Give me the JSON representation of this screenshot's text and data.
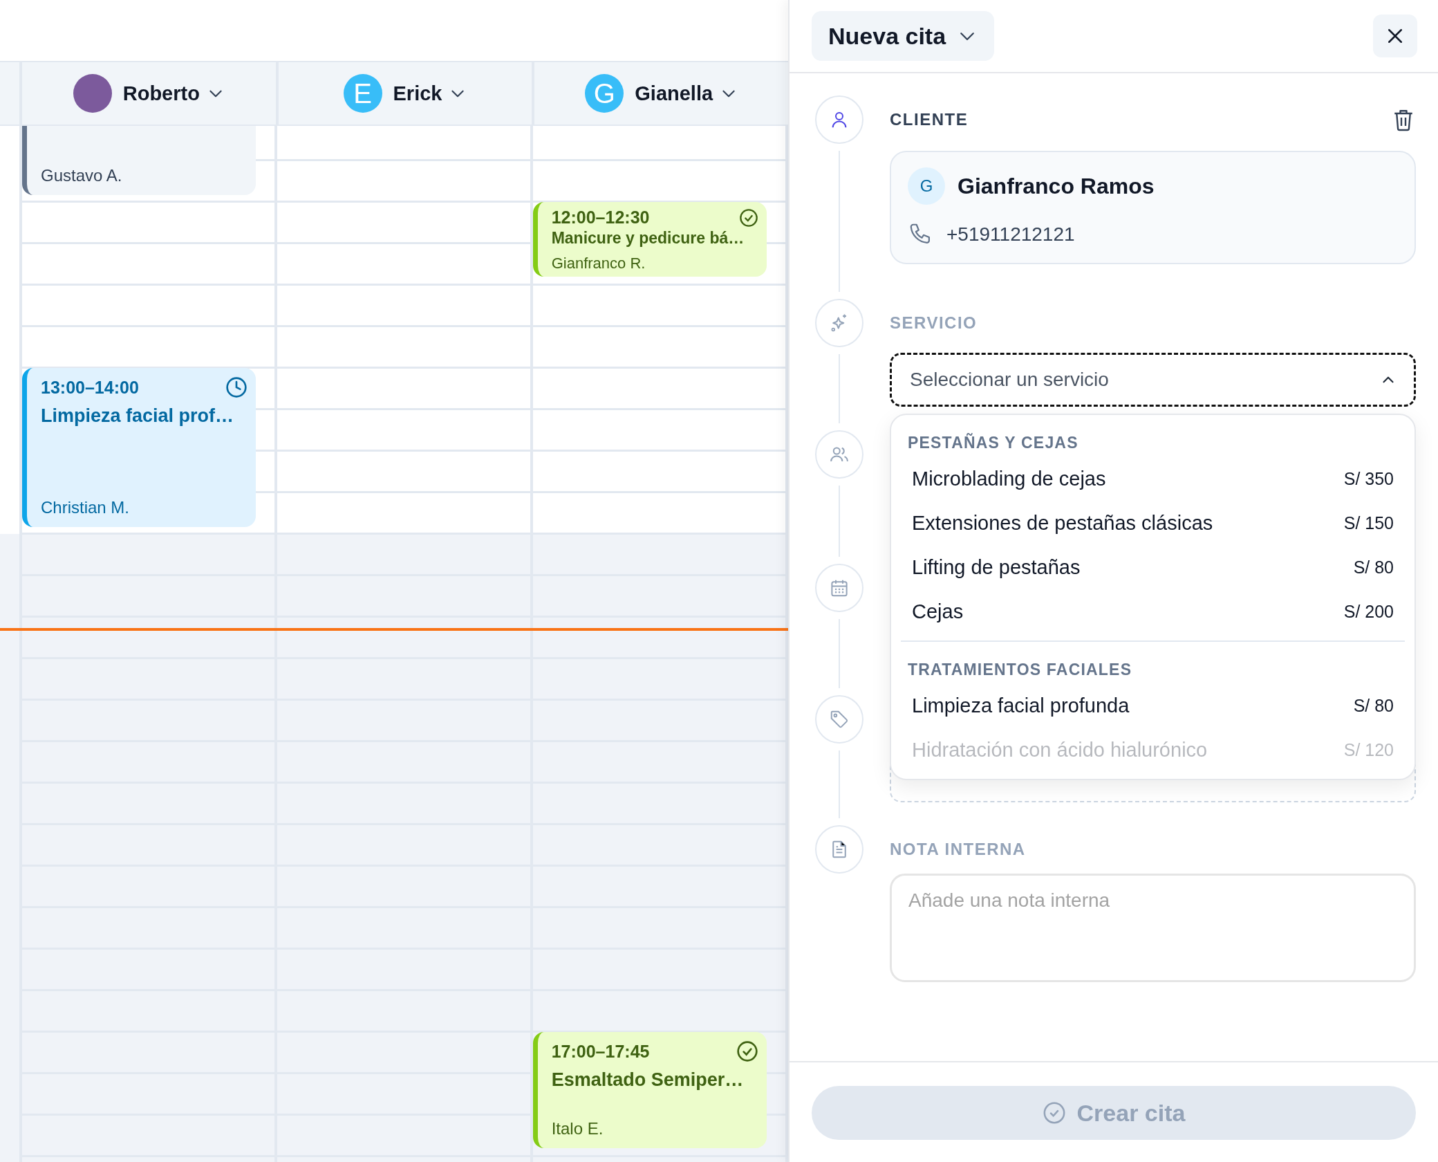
{
  "calendar": {
    "staff": [
      {
        "name": "Roberto",
        "events": [
          {
            "kind": "past",
            "client": "Gustavo A."
          },
          {
            "kind": "scheduled",
            "time": "13:00–14:00",
            "title": "Limpieza facial prof…",
            "client": "Christian M."
          }
        ]
      },
      {
        "name": "Erick",
        "initial": "E"
      },
      {
        "name": "Gianella",
        "initial": "G",
        "events": [
          {
            "kind": "done",
            "time": "12:00–12:30",
            "title": "Manicure y pedicure bá…",
            "client": "Gianfranco R."
          },
          {
            "kind": "done",
            "time": "17:00–17:45",
            "title": "Esmaltado Semiper…",
            "client": "Italo E."
          }
        ]
      }
    ]
  },
  "panel": {
    "title": "Nueva cita",
    "sections": [
      {
        "kind": "client",
        "active": true,
        "label": "CLIENTE",
        "client": {
          "initial": "G",
          "name": "Gianfranco Ramos",
          "phone": "+51911212121"
        }
      },
      {
        "kind": "service",
        "active": false,
        "label": "SERVICIO",
        "select": {
          "placeholder": "Seleccionar un servicio",
          "expanded": true,
          "groups": [
            {
              "title": "PESTAÑAS Y CEJAS",
              "items": [
                {
                  "name": "Microblading de cejas",
                  "price": "S/ 350",
                  "faded": false
                },
                {
                  "name": "Extensiones de pestañas clásicas",
                  "price": "S/ 150",
                  "faded": false
                },
                {
                  "name": "Lifting de pestañas",
                  "price": "S/ 80",
                  "faded": false
                },
                {
                  "name": "Cejas",
                  "price": "S/ 200",
                  "faded": false
                }
              ]
            },
            {
              "title": "TRATAMIENTOS FACIALES",
              "items": [
                {
                  "name": "Limpieza facial profunda",
                  "price": "S/ 80",
                  "faded": false
                },
                {
                  "name": "Hidratación con ácido hialurónico",
                  "price": "S/ 120",
                  "faded": true
                }
              ]
            }
          ]
        }
      },
      {
        "kind": "staff"
      },
      {
        "kind": "date"
      },
      {
        "kind": "tag"
      },
      {
        "kind": "note",
        "active": false,
        "label": "NOTA INTERNA",
        "placeholder": "Añade una nota interna"
      }
    ],
    "submit": {
      "label": "Crear cita",
      "disabled": true
    }
  }
}
